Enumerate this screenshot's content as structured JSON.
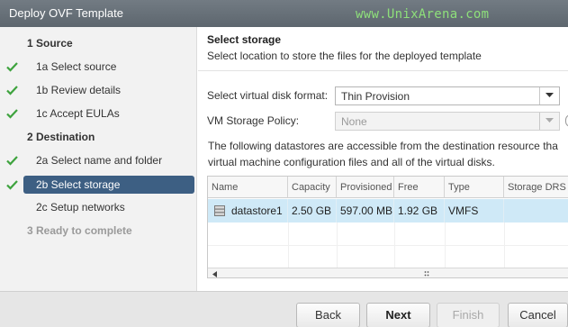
{
  "window": {
    "title": "Deploy OVF Template",
    "watermark": "www.UnixArena.com"
  },
  "colors": {
    "titlebar": "#66707a",
    "active_step": "#3d5f83",
    "check": "#3ea33e",
    "selected_row": "#cfe9f7"
  },
  "steps": [
    {
      "label": "1  Source",
      "kind": "section",
      "done": false
    },
    {
      "label": "1a  Select source",
      "kind": "item",
      "done": true
    },
    {
      "label": "1b  Review details",
      "kind": "item",
      "done": true
    },
    {
      "label": "1c  Accept EULAs",
      "kind": "item",
      "done": true
    },
    {
      "label": "2  Destination",
      "kind": "section",
      "done": false
    },
    {
      "label": "2a  Select name and folder",
      "kind": "item",
      "done": true
    },
    {
      "label": "2b  Select storage",
      "kind": "item",
      "done": true,
      "active": true
    },
    {
      "label": "2c  Setup networks",
      "kind": "item",
      "done": false
    },
    {
      "label": "3  Ready to complete",
      "kind": "section-disabled",
      "done": false
    }
  ],
  "page": {
    "title": "Select storage",
    "subtitle": "Select location to store the files for the deployed template"
  },
  "form": {
    "disk_format_label": "Select virtual disk format:",
    "disk_format_value": "Thin Provision",
    "storage_policy_label": "VM Storage Policy:",
    "storage_policy_value": "None"
  },
  "description": {
    "line1": "The following datastores are accessible from the destination resource tha",
    "line2": "virtual machine configuration files and all of the virtual disks."
  },
  "table": {
    "columns": [
      "Name",
      "Capacity",
      "Provisioned",
      "Free",
      "Type",
      "Storage DRS"
    ],
    "rows": [
      {
        "name": "datastore1",
        "capacity": "2.50 GB",
        "provisioned": "597.00 MB",
        "free": "1.92 GB",
        "type": "VMFS",
        "storage_drs": ""
      }
    ]
  },
  "icons": {
    "check": "check-icon",
    "dropdown": "chevron-down-icon",
    "datastore": "datastore-icon",
    "scroll_left": "arrow-left-icon",
    "grip": "resize-grip-icon",
    "info": "info-icon"
  },
  "buttons": {
    "back": "Back",
    "next": "Next",
    "finish": "Finish",
    "cancel": "Cancel"
  }
}
